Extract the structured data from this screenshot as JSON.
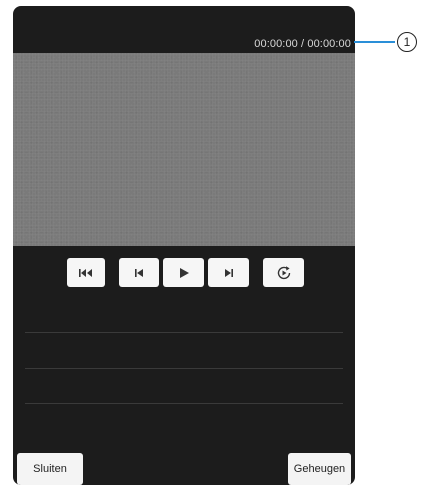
{
  "player": {
    "time_readout": "00:00:00 / 00:00:00"
  },
  "controls": {
    "first_icon": "skip-to-start-icon",
    "prev_icon": "previous-icon",
    "play_icon": "play-icon",
    "next_icon": "next-icon",
    "repeat_icon": "repeat-icon"
  },
  "footer": {
    "close_label": "Sluiten",
    "memory_label": "Geheugen"
  },
  "callout": {
    "number": "1"
  },
  "colors": {
    "panel_bg": "#1c1c1c",
    "video_bg": "#7a7a7a",
    "button_bg": "#f6f6f6",
    "callout_line": "#2a8fd8"
  }
}
